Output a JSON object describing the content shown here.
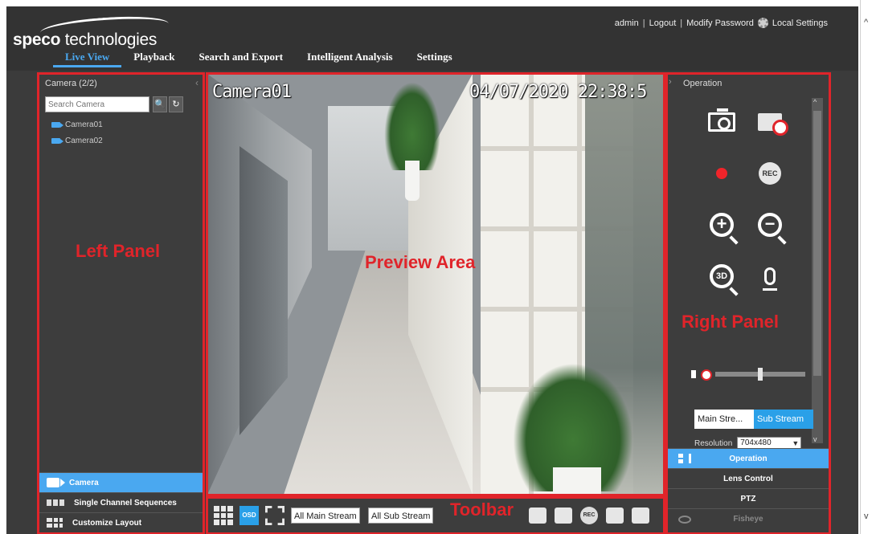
{
  "header": {
    "brand_bold": "speco",
    "brand_rest": " technologies",
    "tabs": [
      {
        "label": "Live View",
        "active": true
      },
      {
        "label": "Playback",
        "active": false
      },
      {
        "label": "Search and Export",
        "active": false
      },
      {
        "label": "Intelligent Analysis",
        "active": false
      },
      {
        "label": "Settings",
        "active": false
      }
    ],
    "user": "admin",
    "sep1": "|",
    "logout": "Logout",
    "sep2": "|",
    "modify_password": "Modify Password",
    "local_settings": "Local Settings"
  },
  "left_panel": {
    "title": "Camera (2/2)",
    "collapse_glyph": "‹",
    "search_placeholder": "Search Camera",
    "search_glyph": "🔍",
    "refresh_glyph": "↻",
    "cameras": [
      "Camera01",
      "Camera02"
    ],
    "bottom_items": [
      {
        "label": "Camera",
        "icon": "camera-icon",
        "active": true
      },
      {
        "label": "Single Channel Sequences",
        "icon": "sequence-icon",
        "active": false
      },
      {
        "label": "Customize Layout",
        "icon": "layout-grid-icon",
        "active": false
      }
    ]
  },
  "preview": {
    "camera_name": "Camera01",
    "timestamp": "04/07/2020 22:38:5"
  },
  "toolbar": {
    "osd_label": "OSD",
    "all_main_stream": "All Main Stream",
    "all_sub_stream": "All Sub Stream",
    "rec_label": "REC"
  },
  "right_panel": {
    "title": "Operation",
    "chevron": "›",
    "rec_label": "REC",
    "zoom_in_glyph": "+",
    "zoom_out_glyph": "−",
    "zoom_3d_glyph": "3D",
    "volume_level": 0.5,
    "main_stream": "Main Stre...",
    "sub_stream": "Sub Stream",
    "resolution_label": "Resolution",
    "resolution_value": "704x480",
    "bottom_items": [
      {
        "label": "Operation",
        "active": true
      },
      {
        "label": "Lens Control",
        "active": false
      },
      {
        "label": "PTZ",
        "active": false
      },
      {
        "label": "Fisheye",
        "active": false
      }
    ]
  },
  "annotations": {
    "left_panel": "Left Panel",
    "preview_area": "Preview Area",
    "right_panel": "Right Panel",
    "toolbar": "Toolbar"
  },
  "colors": {
    "accent": "#4aa8f0",
    "annotation": "#e0242a",
    "panel": "#3d3d3d"
  }
}
